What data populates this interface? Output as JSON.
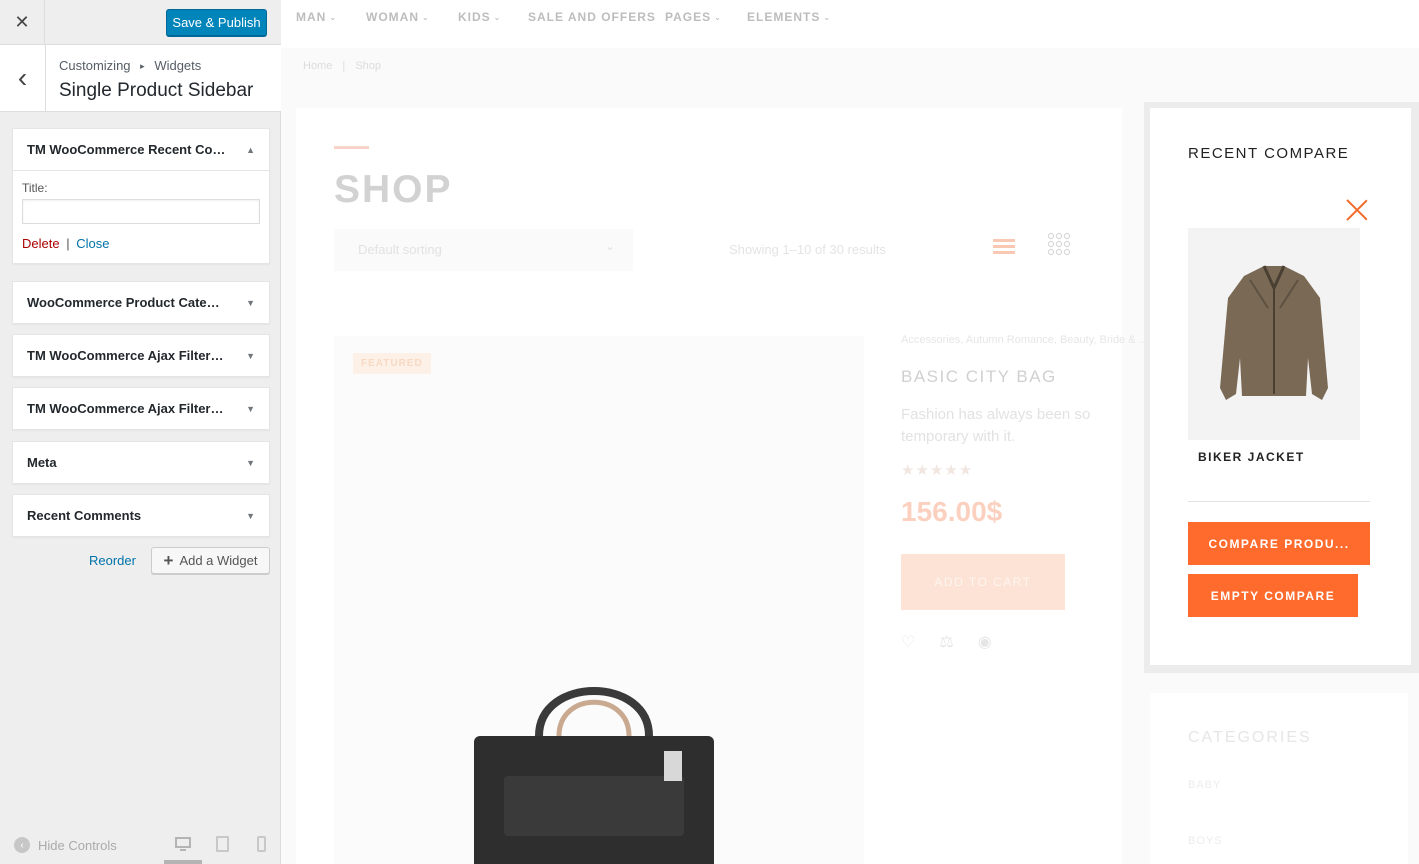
{
  "customizer": {
    "close_glyph": "✕",
    "save_label": "Save & Publish",
    "back_glyph": "‹",
    "breadcrumb": {
      "root": "Customizing",
      "sep": "▸",
      "section": "Widgets"
    },
    "section_title": "Single Product Sidebar",
    "widgets": [
      {
        "name": "TM WooCommerce Recent Com...",
        "expanded": true,
        "arrow": "▲"
      },
      {
        "name": "WooCommerce Product Categor...",
        "expanded": false,
        "arrow": "▼"
      },
      {
        "name": "TM WooCommerce Ajax Filters: ...",
        "expanded": false,
        "arrow": "▼"
      },
      {
        "name": "TM WooCommerce Ajax Filters: ...",
        "expanded": false,
        "arrow": "▼"
      },
      {
        "name": "Meta",
        "expanded": false,
        "arrow": "▼"
      },
      {
        "name": "Recent Comments",
        "expanded": false,
        "arrow": "▼"
      }
    ],
    "widget_form": {
      "title_label": "Title:",
      "title_value": "",
      "delete_label": "Delete",
      "separator": "|",
      "close_label": "Close"
    },
    "reorder_label": "Reorder",
    "add_widget_label": "Add a Widget",
    "add_widget_icon": "+",
    "hide_controls_label": "Hide Controls",
    "hide_controls_icon": "‹",
    "devices": [
      "desktop-icon",
      "tablet-icon",
      "mobile-icon"
    ]
  },
  "preview": {
    "nav": [
      {
        "label": "MAN",
        "has_dropdown": true
      },
      {
        "label": "WOMAN",
        "has_dropdown": true
      },
      {
        "label": "KIDS",
        "has_dropdown": true
      },
      {
        "label": "SALE AND OFFERS",
        "has_dropdown": false
      },
      {
        "label": "PAGES",
        "has_dropdown": true
      },
      {
        "label": "ELEMENTS",
        "has_dropdown": true
      }
    ],
    "chevron_glyph": "⌄",
    "breadcrumbs": {
      "home": "Home",
      "sep": "|",
      "current": "Shop"
    },
    "shop_title": "SHOP",
    "sorting": {
      "value": "Default sorting",
      "dropdown_glyph": "⌄"
    },
    "results_text": "Showing 1–10 of 30 results",
    "product": {
      "badge": "FEATURED",
      "categories": "Accessories, Autumn Romance, Beauty, Bride & ...",
      "name": "BASIC CITY BAG",
      "description": "Fashion has always been so temporary with it.",
      "stars": "★★★★★",
      "price": "156.00$",
      "add_to_cart": "ADD TO CART",
      "icons": [
        "heart-icon",
        "compare-icon",
        "eye-icon"
      ],
      "icon_glyphs": [
        "♡",
        "⚖",
        "◉"
      ]
    },
    "compare": {
      "title": "RECENT COMPARE",
      "item_name": "BIKER JACKET",
      "compare_button": "COMPARE PRODU...",
      "empty_button": "EMPTY COMPARE"
    },
    "categories": {
      "title": "CATEGORIES",
      "items": [
        "BABY",
        "BOYS"
      ]
    },
    "colors": {
      "accent": "#ff6b2c",
      "wp_blue": "#0085ba"
    }
  }
}
